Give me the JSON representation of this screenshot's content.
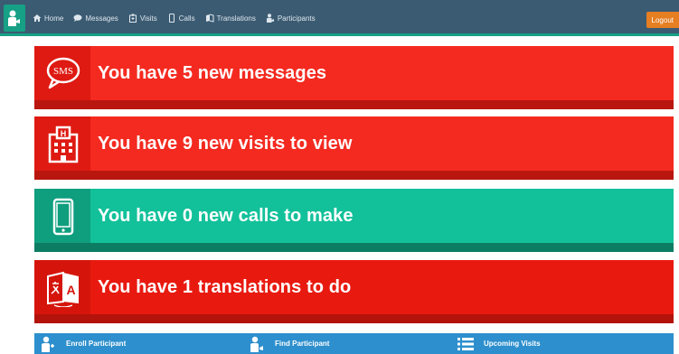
{
  "nav": {
    "items": [
      {
        "label": "Home",
        "icon": "home-icon"
      },
      {
        "label": "Messages",
        "icon": "chat-icon"
      },
      {
        "label": "Visits",
        "icon": "hospital-icon"
      },
      {
        "label": "Calls",
        "icon": "phone-icon"
      },
      {
        "label": "Translations",
        "icon": "translate-icon"
      },
      {
        "label": "Participants",
        "icon": "participant-icon"
      }
    ],
    "logout": "Logout"
  },
  "tiles": {
    "messages": {
      "text": "You have 5 new messages",
      "icon_text": "SMS",
      "color": "#f42a20"
    },
    "visits": {
      "text": "You have 9 new visits to view",
      "icon_text": "H",
      "color": "#f42a20"
    },
    "calls": {
      "text": "You have 0 new calls to make",
      "color": "#12c19a"
    },
    "translations": {
      "text": "You have 1 translations to do",
      "icon_text": "A",
      "color": "#e81a10"
    }
  },
  "bottom": {
    "items": [
      {
        "label": "Enroll Participant",
        "icon": "enroll-icon"
      },
      {
        "label": "Find Participant",
        "icon": "find-participant-icon"
      },
      {
        "label": "Upcoming Visits",
        "icon": "list-icon"
      }
    ]
  },
  "colors": {
    "navbar": "#3b5b72",
    "accent": "#16a085",
    "logout": "#e67e22",
    "bottom_bar": "#2d8fcd"
  }
}
